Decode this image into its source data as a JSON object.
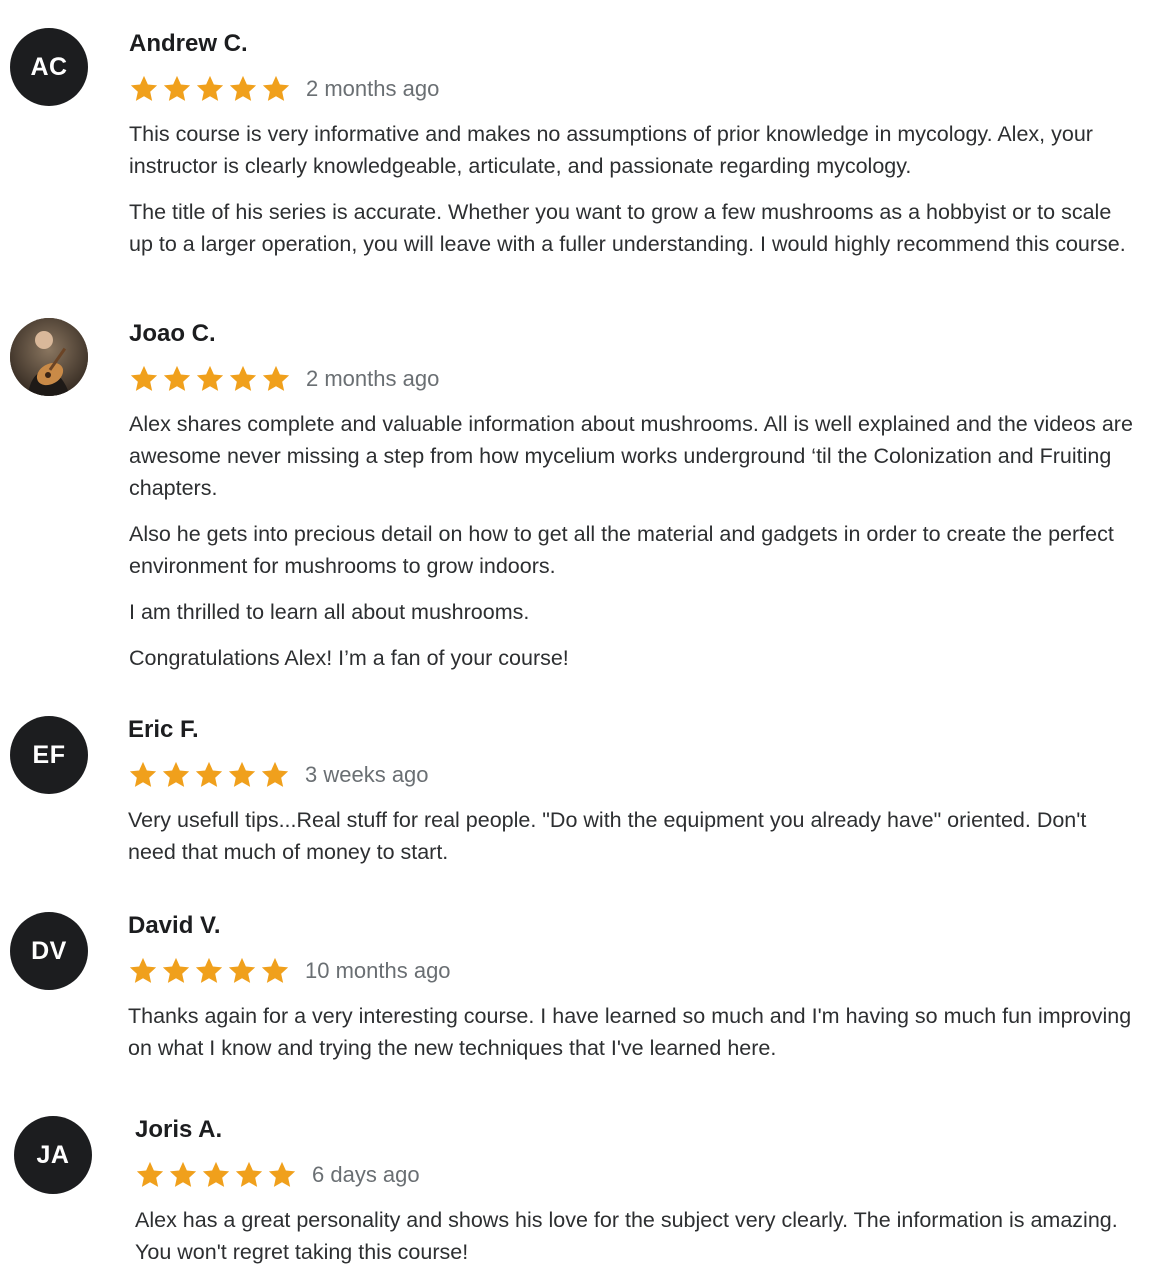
{
  "colors": {
    "star": "#f0a01c",
    "avatar_bg": "#1c1d1f",
    "text": "#2d2f31",
    "muted": "#6a6f73"
  },
  "reviews": [
    {
      "initials": "AC",
      "name": "Andrew C.",
      "rating": 5,
      "time": "2 months ago",
      "paragraphs": [
        "This course is very informative and makes no assumptions of prior knowledge in mycology. Alex, your instructor is clearly knowledgeable, articulate, and passionate regarding mycology.",
        "The title of his series is accurate. Whether you want to grow a few mushrooms as a hobbyist or to scale up to a larger operation, you will leave with a fuller understanding. I would highly recommend this course."
      ]
    },
    {
      "initials": "",
      "avatar_icon": "profile-photo",
      "name": "Joao C.",
      "rating": 5,
      "time": "2 months ago",
      "paragraphs": [
        "Alex shares complete and valuable information about mushrooms. All is well explained and the videos are awesome never missing a step from how mycelium works underground ‘til the Colonization and Fruiting chapters.",
        "Also he gets into precious detail on how to get all the material and gadgets in order to create the perfect environment for mushrooms to grow indoors.",
        "I am thrilled to learn all about mushrooms.",
        "Congratulations Alex! I’m a fan of your course!"
      ]
    },
    {
      "initials": "EF",
      "name": "Eric F.",
      "rating": 5,
      "time": "3 weeks ago",
      "paragraphs": [
        "Very usefull tips...Real stuff for real people. \"Do with the equipment you already have\" oriented. Don't need that much of money to start."
      ]
    },
    {
      "initials": "DV",
      "name": "David V.",
      "rating": 5,
      "time": "10 months ago",
      "paragraphs": [
        "Thanks again for a very interesting course. I have learned so much and I'm having so much fun improving on what I know and trying the new techniques that I've learned here."
      ]
    },
    {
      "initials": "JA",
      "name": "Joris A.",
      "rating": 5,
      "time": "6 days ago",
      "paragraphs": [
        "Alex has a great personality and shows his love for the subject very clearly. The information is amazing. You won't regret taking this course!"
      ]
    }
  ]
}
